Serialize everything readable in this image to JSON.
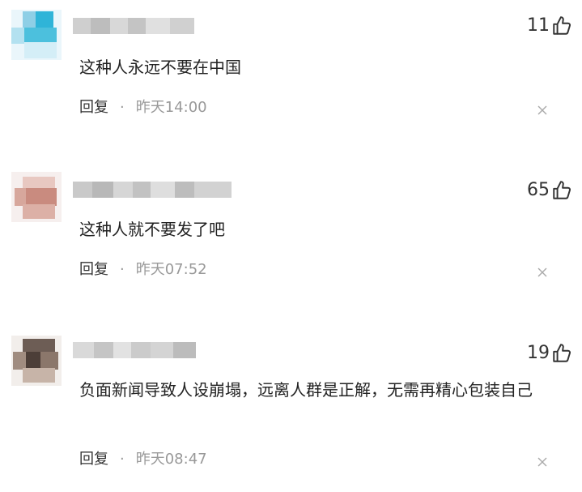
{
  "comments": [
    {
      "likes": "11",
      "text": "这种人永远不要在中国",
      "reply_label": "回复",
      "separator": "·",
      "time": "昨天14:00"
    },
    {
      "likes": "65",
      "text": "这种人就不要发了吧",
      "reply_label": "回复",
      "separator": "·",
      "time": "昨天07:52"
    },
    {
      "likes": "19",
      "text": "负面新闻导致人设崩塌，远离人群是正解，无需再精心包装自己",
      "reply_label": "回复",
      "separator": "·",
      "time": "昨天08:47"
    }
  ],
  "colors": {
    "text": "#222222",
    "meta": "#999999",
    "icon": "#333333"
  },
  "icons": {
    "like": "thumbs-up-icon",
    "dismiss": "close-icon",
    "avatar": "pixelated-avatar"
  }
}
